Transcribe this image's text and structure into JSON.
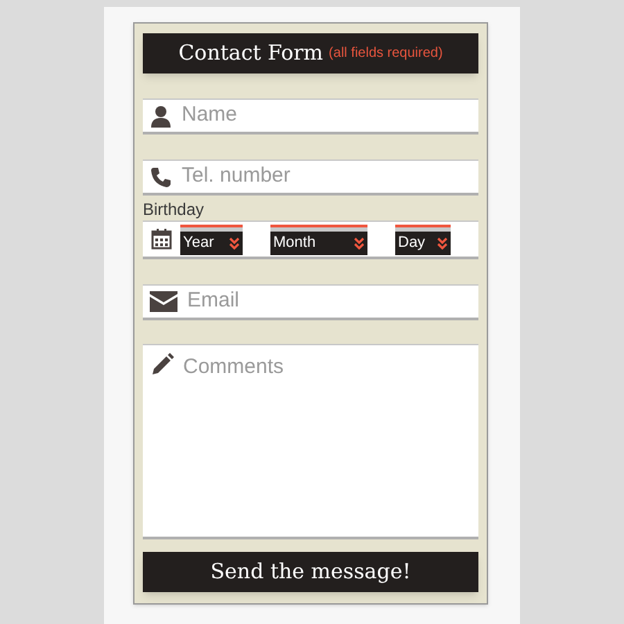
{
  "header": {
    "title": "Contact Form",
    "note": "(all fields required)"
  },
  "name_field": {
    "placeholder": "Name"
  },
  "tel_field": {
    "placeholder": "Tel. number"
  },
  "birthday": {
    "label": "Birthday",
    "selects": [
      {
        "value": "Year"
      },
      {
        "value": "Month"
      },
      {
        "value": "Day"
      }
    ]
  },
  "email_field": {
    "placeholder": "Email"
  },
  "comments_field": {
    "placeholder": "Comments"
  },
  "submit_button": {
    "label": "Send the message!"
  }
}
